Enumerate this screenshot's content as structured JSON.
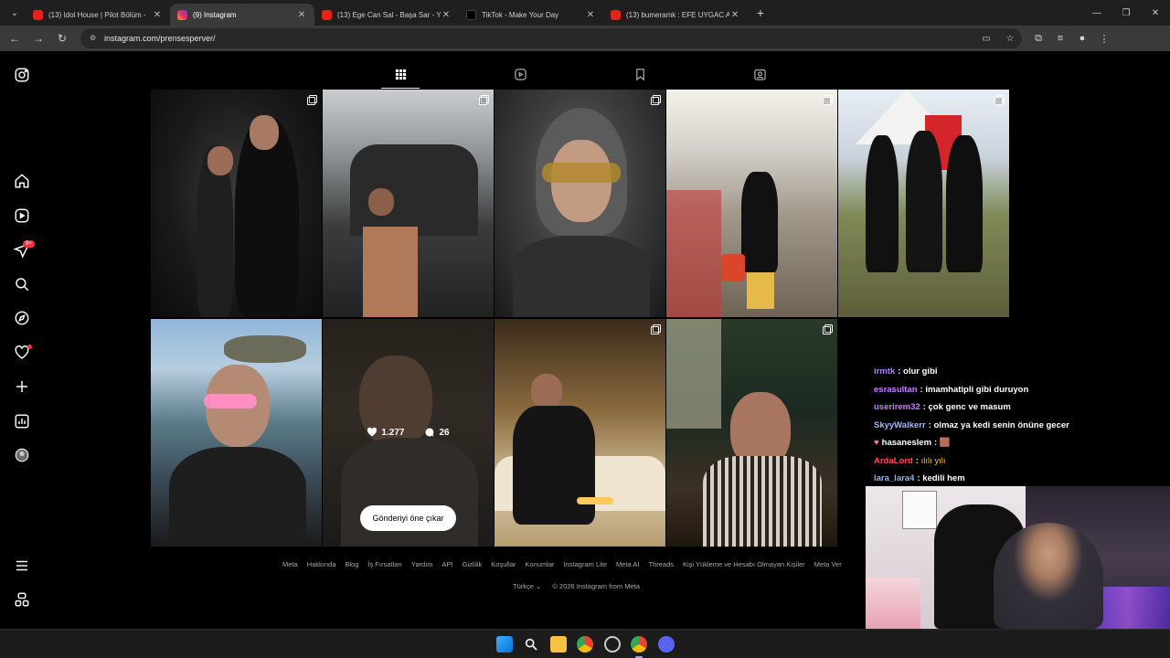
{
  "browser": {
    "tabs": [
      {
        "title": "(13) Idol House | Pilot Bölüm -",
        "icon": "youtube-icon",
        "active": false
      },
      {
        "title": "(9) Instagram",
        "icon": "instagram-icon",
        "active": true
      },
      {
        "title": "(13) Ege Can Sal - Başa Sar - Yo",
        "icon": "youtube-icon",
        "active": false
      },
      {
        "title": "TikTok - Make Your Day",
        "icon": "tiktok-icon",
        "active": false
      },
      {
        "title": "(13) bumeramk : EFE UYGAC A",
        "icon": "youtube-icon",
        "active": false
      }
    ],
    "close_glyph": "✕",
    "new_tab_glyph": "+",
    "url": "instagram.com/prensesperver/"
  },
  "instagram": {
    "notification_badge": "9+",
    "profile_tabs": [
      "posts-grid-icon",
      "reels-icon",
      "saved-icon",
      "tagged-icon"
    ],
    "hovered_post": {
      "likes": "1.277",
      "comments": "26",
      "pin_button": "Gönderiyi öne çıkar"
    },
    "footer_links": [
      "Meta",
      "Hakkında",
      "Blog",
      "İş Fırsatları",
      "Yardım",
      "API",
      "Gizlilik",
      "Koşullar",
      "Konumlar",
      "Instagram Lite",
      "Meta AI",
      "Threads",
      "Kişi Yükleme ve Hesabı Olmayan Kişiler",
      "Meta Ver"
    ],
    "language": "Türkçe",
    "copyright": "© 2026 Instagram from Meta"
  },
  "chat": [
    {
      "user": "irmtk",
      "color": "#b57cff",
      "message": "olur gibi"
    },
    {
      "user": "esrasultan",
      "color": "#c77dff",
      "message": "imamhatipli gibi duruyon"
    },
    {
      "user": "userirem32",
      "color": "#c77dff",
      "message": "çok genc ve masum"
    },
    {
      "user": "SkyyWalkerr",
      "color": "#9fb8ff",
      "message": "olmaz ya kedi senin önüne gecer"
    },
    {
      "user": "hasaneslem",
      "color": "#ffffff",
      "message": "🟫"
    },
    {
      "user": "ArdaLord",
      "color": "#ff4d4d",
      "message": "ılılı yılı"
    },
    {
      "user": "lara_lara4",
      "color": "#8ab4ff",
      "message": "kedili hem"
    }
  ]
}
